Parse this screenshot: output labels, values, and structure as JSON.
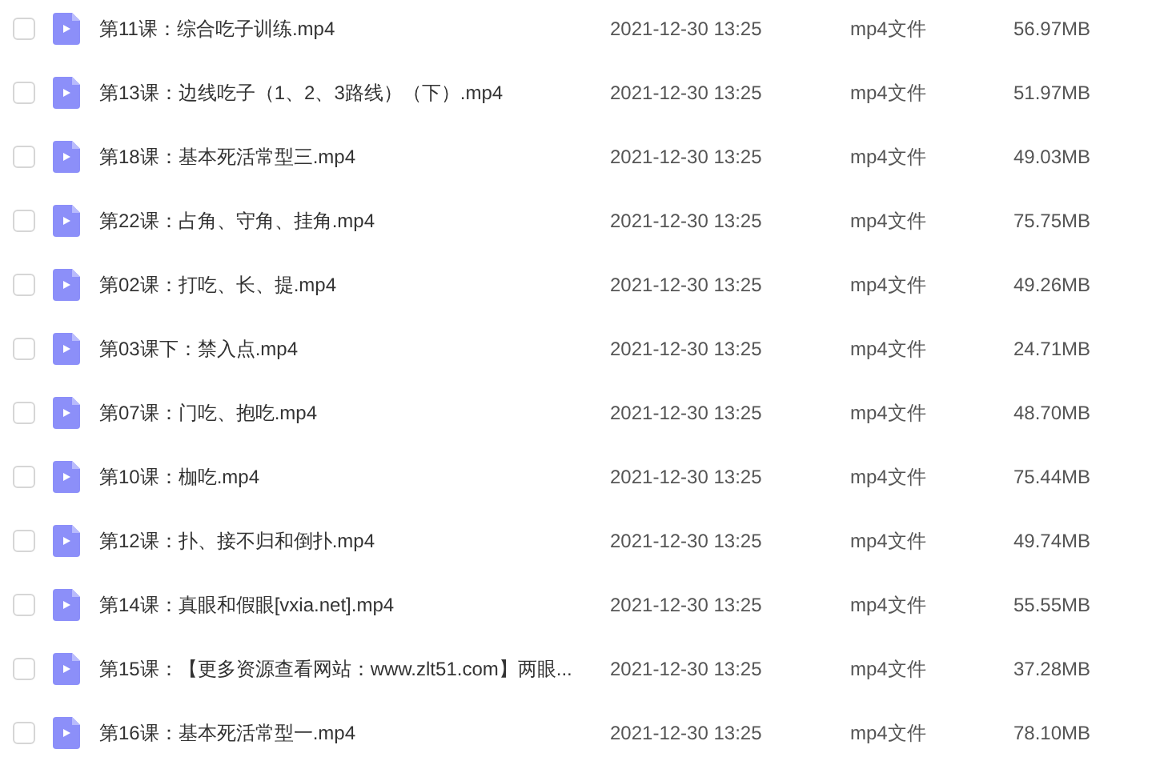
{
  "files": [
    {
      "name": "第11课：综合吃子训练.mp4",
      "modified": "2021-12-30 13:25",
      "type": "mp4文件",
      "size": "56.97MB",
      "checked": false
    },
    {
      "name": "第13课：边线吃子（1、2、3路线）（下）.mp4",
      "modified": "2021-12-30 13:25",
      "type": "mp4文件",
      "size": "51.97MB",
      "checked": false
    },
    {
      "name": "第18课：基本死活常型三.mp4",
      "modified": "2021-12-30 13:25",
      "type": "mp4文件",
      "size": "49.03MB",
      "checked": false
    },
    {
      "name": "第22课：占角、守角、挂角.mp4",
      "modified": "2021-12-30 13:25",
      "type": "mp4文件",
      "size": "75.75MB",
      "checked": false
    },
    {
      "name": "第02课：打吃、长、提.mp4",
      "modified": "2021-12-30 13:25",
      "type": "mp4文件",
      "size": "49.26MB",
      "checked": false
    },
    {
      "name": "第03课下：禁入点.mp4",
      "modified": "2021-12-30 13:25",
      "type": "mp4文件",
      "size": "24.71MB",
      "checked": false
    },
    {
      "name": "第07课：门吃、抱吃.mp4",
      "modified": "2021-12-30 13:25",
      "type": "mp4文件",
      "size": "48.70MB",
      "checked": false
    },
    {
      "name": "第10课：枷吃.mp4",
      "modified": "2021-12-30 13:25",
      "type": "mp4文件",
      "size": "75.44MB",
      "checked": false
    },
    {
      "name": "第12课：扑、接不归和倒扑.mp4",
      "modified": "2021-12-30 13:25",
      "type": "mp4文件",
      "size": "49.74MB",
      "checked": false
    },
    {
      "name": "第14课：真眼和假眼[vxia.net].mp4",
      "modified": "2021-12-30 13:25",
      "type": "mp4文件",
      "size": "55.55MB",
      "checked": false
    },
    {
      "name": "第15课：【更多资源查看网站：www.zlt51.com】两眼...",
      "modified": "2021-12-30 13:25",
      "type": "mp4文件",
      "size": "37.28MB",
      "checked": false
    },
    {
      "name": "第16课：基本死活常型一.mp4",
      "modified": "2021-12-30 13:25",
      "type": "mp4文件",
      "size": "78.10MB",
      "checked": false
    }
  ]
}
